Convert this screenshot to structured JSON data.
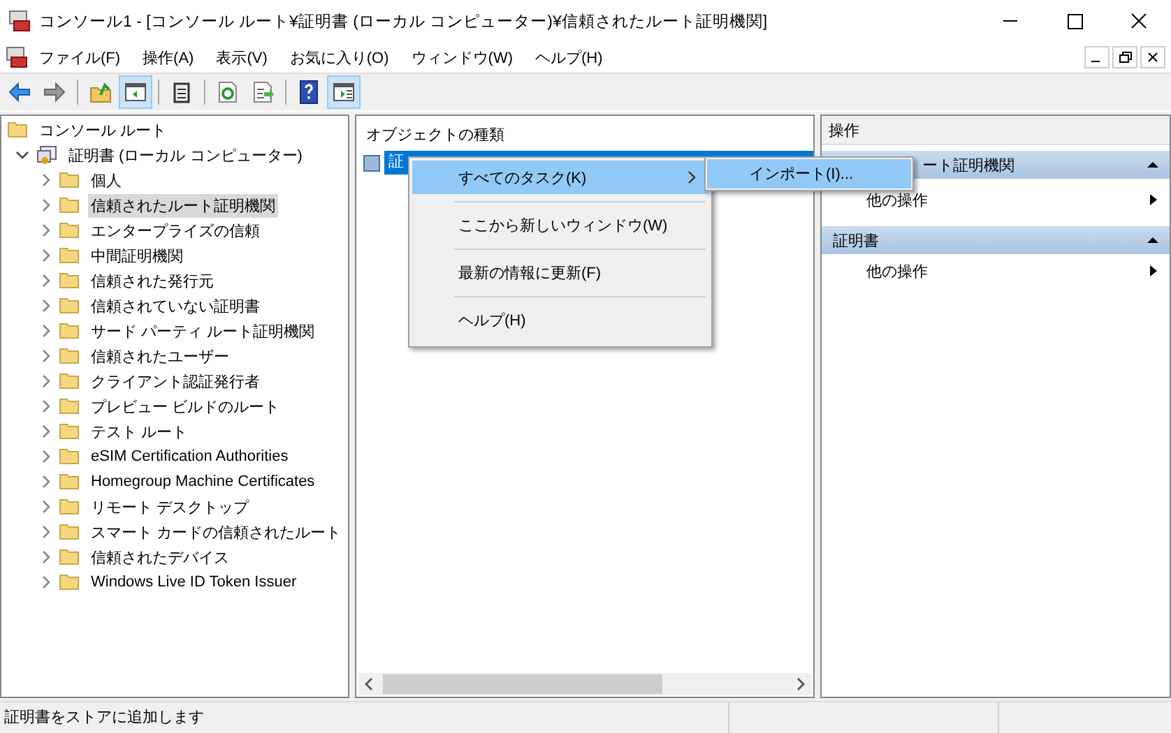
{
  "window": {
    "title": "コンソール1 - [コンソール ルート¥証明書 (ローカル コンピューター)¥信頼されたルート証明機関]"
  },
  "menu_bar": {
    "items": [
      "ファイル(F)",
      "操作(A)",
      "表示(V)",
      "お気に入り(O)",
      "ウィンドウ(W)",
      "ヘルプ(H)"
    ]
  },
  "toolbar": [
    {
      "kind": "back",
      "on": false
    },
    {
      "kind": "forward",
      "on": false
    },
    {
      "kind": "up",
      "on": false
    },
    {
      "kind": "tree",
      "on": true
    },
    {
      "kind": "clipboard",
      "on": false
    },
    {
      "kind": "refresh",
      "on": false
    },
    {
      "kind": "export",
      "on": false
    },
    {
      "kind": "help",
      "on": false
    },
    {
      "kind": "actionpane",
      "on": true
    }
  ],
  "tree": {
    "root": "コンソール ルート",
    "children": [
      {
        "label": "証明書 (ローカル コンピューター)",
        "expanded": true,
        "selected": false,
        "children": [
          {
            "label": "個人",
            "expanded": false,
            "selected": false
          },
          {
            "label": "信頼されたルート証明機関",
            "expanded": false,
            "selected": true
          },
          {
            "label": "エンタープライズの信頼",
            "expanded": false,
            "selected": false
          },
          {
            "label": "中間証明機関",
            "expanded": false,
            "selected": false
          },
          {
            "label": "信頼された発行元",
            "expanded": false,
            "selected": false
          },
          {
            "label": "信頼されていない証明書",
            "expanded": false,
            "selected": false
          },
          {
            "label": "サード パーティ ルート証明機関",
            "expanded": false,
            "selected": false
          },
          {
            "label": "信頼されたユーザー",
            "expanded": false,
            "selected": false
          },
          {
            "label": "クライアント認証発行者",
            "expanded": false,
            "selected": false
          },
          {
            "label": "プレビュー ビルドのルート",
            "expanded": false,
            "selected": false
          },
          {
            "label": "テスト ルート",
            "expanded": false,
            "selected": false
          },
          {
            "label": "eSIM Certification Authorities",
            "expanded": false,
            "selected": false
          },
          {
            "label": "Homegroup Machine Certificates",
            "expanded": false,
            "selected": false
          },
          {
            "label": "リモート デスクトップ",
            "expanded": false,
            "selected": false
          },
          {
            "label": "スマート カードの信頼されたルート",
            "expanded": false,
            "selected": false
          },
          {
            "label": "信頼されたデバイス",
            "expanded": false,
            "selected": false
          },
          {
            "label": "Windows Live ID Token Issuer",
            "expanded": false,
            "selected": false
          }
        ]
      }
    ]
  },
  "center": {
    "column_header": "オブジェクトの種類",
    "items": [
      {
        "label": "証",
        "selected": true
      }
    ]
  },
  "actions": {
    "title": "操作",
    "sections": [
      {
        "header": "ート証明機関",
        "expanded": true,
        "items": [
          "他の操作"
        ]
      },
      {
        "header": "証明書",
        "expanded": true,
        "items": [
          "他の操作"
        ]
      }
    ]
  },
  "context_menu": {
    "items": [
      {
        "label": "すべてのタスク(K)",
        "submenu": true,
        "selected": true
      },
      {
        "label": "ここから新しいウィンドウ(W)",
        "submenu": false,
        "selected": false
      },
      {
        "label": "最新の情報に更新(F)",
        "submenu": false,
        "selected": false
      },
      {
        "label": "ヘルプ(H)",
        "submenu": false,
        "selected": false
      }
    ]
  },
  "submenu": {
    "items": [
      {
        "label": "インポート(I)...",
        "selected": true
      }
    ]
  },
  "status_bar": {
    "text": "証明書をストアに追加します"
  }
}
